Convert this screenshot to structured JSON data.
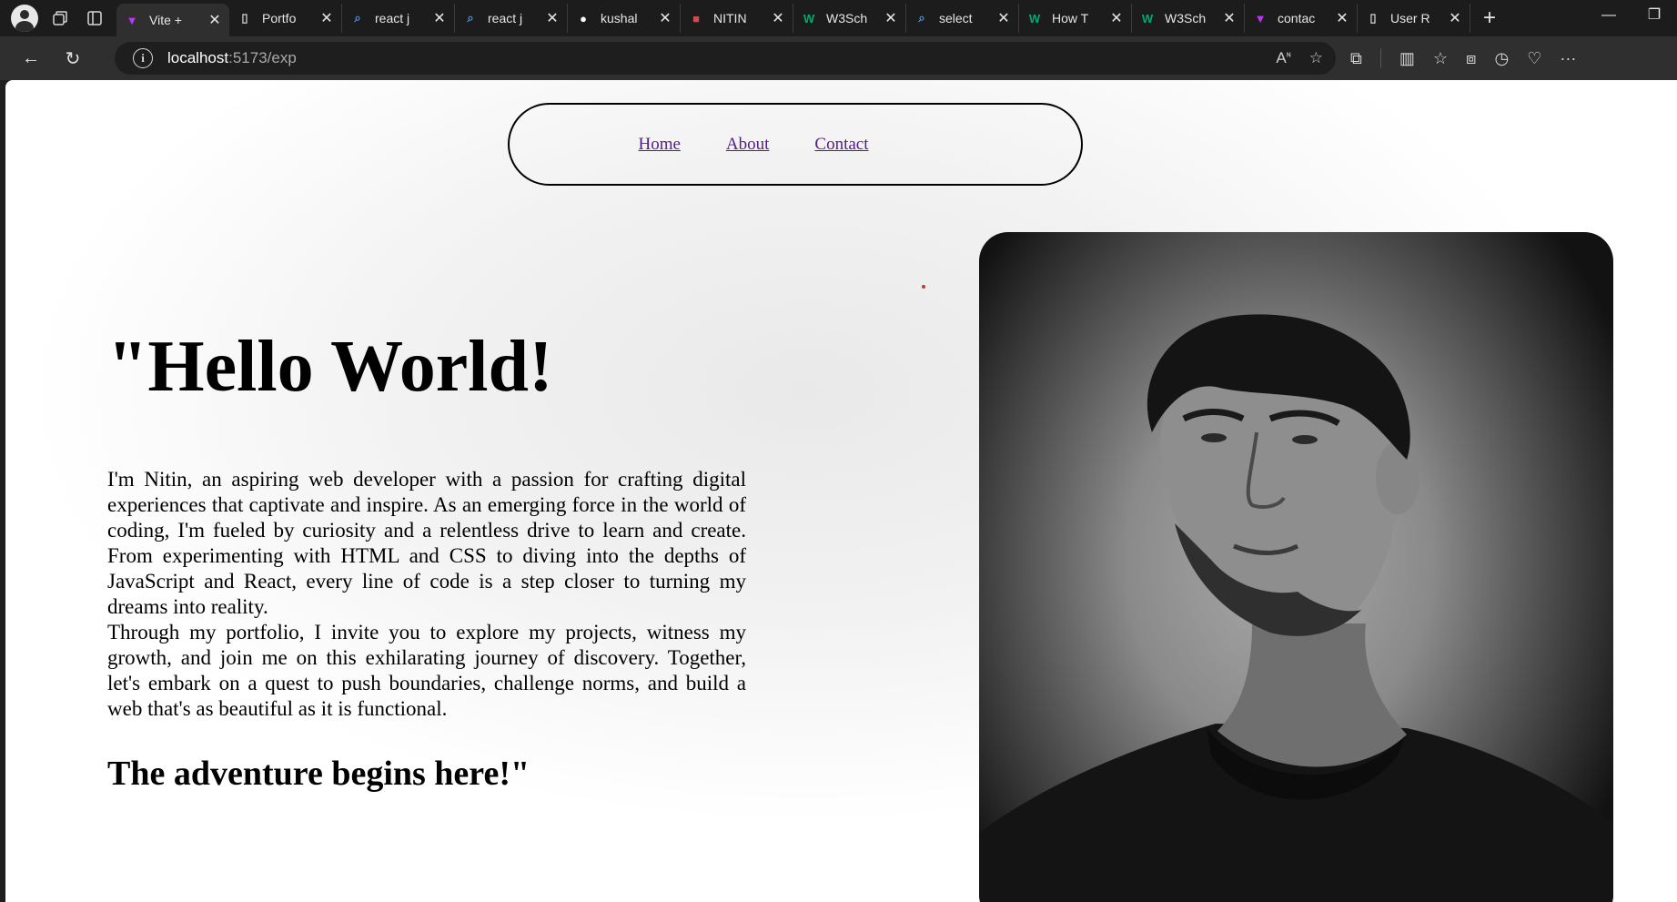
{
  "browser": {
    "tabs": [
      {
        "title": "Vite + ",
        "icon": "vite-icon",
        "active": true
      },
      {
        "title": "Portfo",
        "icon": "page-icon"
      },
      {
        "title": "react j",
        "icon": "search-icon"
      },
      {
        "title": "react j",
        "icon": "search-icon"
      },
      {
        "title": "kushal",
        "icon": "github-icon"
      },
      {
        "title": "NITIN",
        "icon": "pdf-icon"
      },
      {
        "title": "W3Sch",
        "icon": "w3schools-icon"
      },
      {
        "title": "select",
        "icon": "search-icon"
      },
      {
        "title": "How T",
        "icon": "w3schools-icon"
      },
      {
        "title": "W3Sch",
        "icon": "w3schools-icon"
      },
      {
        "title": "contac",
        "icon": "vite-icon"
      },
      {
        "title": "User R",
        "icon": "page-icon"
      }
    ],
    "url_host": "localhost",
    "url_path": ":5173/exp"
  },
  "nav": {
    "home": "Home",
    "about": "About",
    "contact": "Contact"
  },
  "hero": {
    "title": "\"Hello World!",
    "paragraph1": "I'm Nitin, an aspiring web developer with a passion for crafting digital experiences that captivate and inspire. As an emerging force in the world of coding, I'm fueled by curiosity and a relentless drive to learn and create. From experimenting with HTML and CSS to diving into the depths of JavaScript and React, every line of code is a step closer to turning my dreams into reality.",
    "paragraph2": "Through my portfolio, I invite you to explore my projects, witness my growth, and join me on this exhilarating journey of discovery. Together, let's embark on a quest to push boundaries, challenge norms, and build a web that's as beautiful as it is functional.",
    "tagline": "The adventure begins here!\""
  },
  "colors": {
    "link": "#551a8b",
    "vite_accent": "#bd34fe",
    "w3schools_accent": "#04aa6d"
  }
}
